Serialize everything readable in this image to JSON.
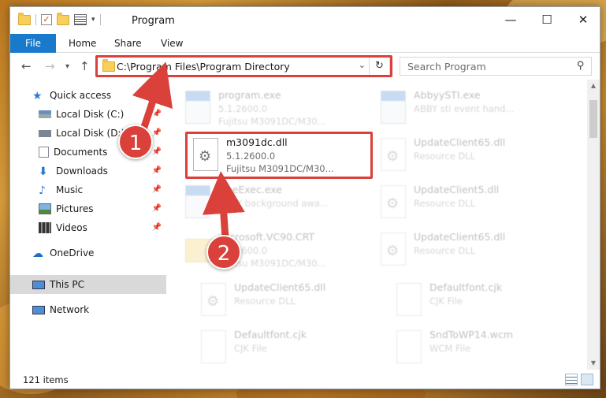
{
  "window": {
    "title": "Program",
    "controls": {
      "minimize": "—",
      "maximize": "☐",
      "close": "✕"
    }
  },
  "ribbon": {
    "tabs": [
      "File",
      "Home",
      "Share",
      "View"
    ]
  },
  "address": {
    "path": "C:\\Program Files\\Program Directory",
    "dropdown": "⌄",
    "refresh": "↻"
  },
  "search": {
    "placeholder": "Search Program"
  },
  "navpane": {
    "items": [
      {
        "label": "Quick access"
      },
      {
        "label": "Local Disk (C:)"
      },
      {
        "label": "Local Disk (D:)"
      },
      {
        "label": "Documents"
      },
      {
        "label": "Downloads"
      },
      {
        "label": "Music"
      },
      {
        "label": "Pictures"
      },
      {
        "label": "Videos"
      },
      {
        "label": "OneDrive"
      },
      {
        "label": "This PC"
      },
      {
        "label": "Network"
      }
    ]
  },
  "files": [
    {
      "name": "program.exe",
      "line2": "5.1.2600.0",
      "line3": "Fujitsu M3091DC/M30..."
    },
    {
      "name": "AbbyySTI.exe",
      "line2": "ABBY sti event hand...",
      "line3": ""
    },
    {
      "name": "m3091dc.dll",
      "line2": "5.1.2600.0",
      "line3": "Fujitsu M3091DC/M30..."
    },
    {
      "name": "UpdateClient65.dll",
      "line2": "Resource DLL",
      "line3": ""
    },
    {
      "name": "FineExec.exe",
      "line2": "ABBY background awa...",
      "line3": ""
    },
    {
      "name": "UpdateClient5.dll",
      "line2": "Resource DLL",
      "line3": ""
    },
    {
      "name": "Microsoft.VC90.CRT",
      "line2": "5.1.2600.0",
      "line3": "Fujitsu M3091DC/M30..."
    },
    {
      "name": "UpdateClient65.dll",
      "line2": "Resource DLL",
      "line3": ""
    },
    {
      "name": "UpdateClient65.dll",
      "line2": "Resource DLL",
      "line3": ""
    },
    {
      "name": "Defaultfont.cjk",
      "line2": "CJK File",
      "line3": ""
    },
    {
      "name": "Defaultfont.cjk",
      "line2": "CJK File",
      "line3": ""
    },
    {
      "name": "SndToWP14.wcm",
      "line2": "WCM File",
      "line3": ""
    }
  ],
  "status": {
    "count": "121 items"
  },
  "annotations": {
    "step1": "1",
    "step2": "2"
  },
  "colors": {
    "accent": "#1979ca",
    "highlight": "#d9413a"
  }
}
